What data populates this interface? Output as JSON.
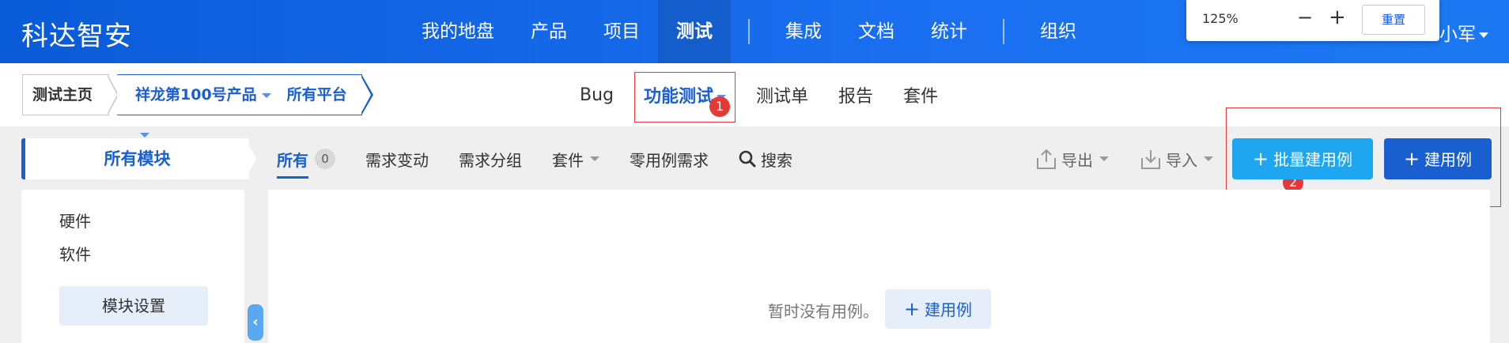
{
  "header": {
    "logo": "科达智安",
    "nav": [
      "我的地盘",
      "产品",
      "项目",
      "测试",
      "集成",
      "文档",
      "统计",
      "组织"
    ],
    "active_nav": "测试",
    "user": "小军"
  },
  "zoom_popup": {
    "value": "125%",
    "minus": "−",
    "plus": "+",
    "reset": "重置"
  },
  "breadcrumb": {
    "home": "测试主页",
    "product": "祥龙第100号产品",
    "platform": "所有平台"
  },
  "subnav": [
    "Bug",
    "功能测试",
    "测试单",
    "报告",
    "套件"
  ],
  "active_subnav": "功能测试",
  "annotations": {
    "badge1": "1",
    "badge2": "2"
  },
  "left": {
    "module_header": "所有模块",
    "modules": [
      "硬件",
      "软件"
    ],
    "module_settings": "模块设置",
    "collapse": "‹"
  },
  "toolbar": {
    "all": "所有",
    "all_count": "0",
    "items": [
      "需求变动",
      "需求分组",
      "套件",
      "零用例需求"
    ],
    "search": "搜索",
    "export": "导出",
    "import": "导入",
    "batch_create": "批量建用例",
    "create": "建用例"
  },
  "empty": {
    "text": "暂时没有用例。",
    "create": "建用例"
  },
  "colors": {
    "brand": "#1a5fd0",
    "accent": "#1ea7f0",
    "annotation": "#e53935"
  }
}
